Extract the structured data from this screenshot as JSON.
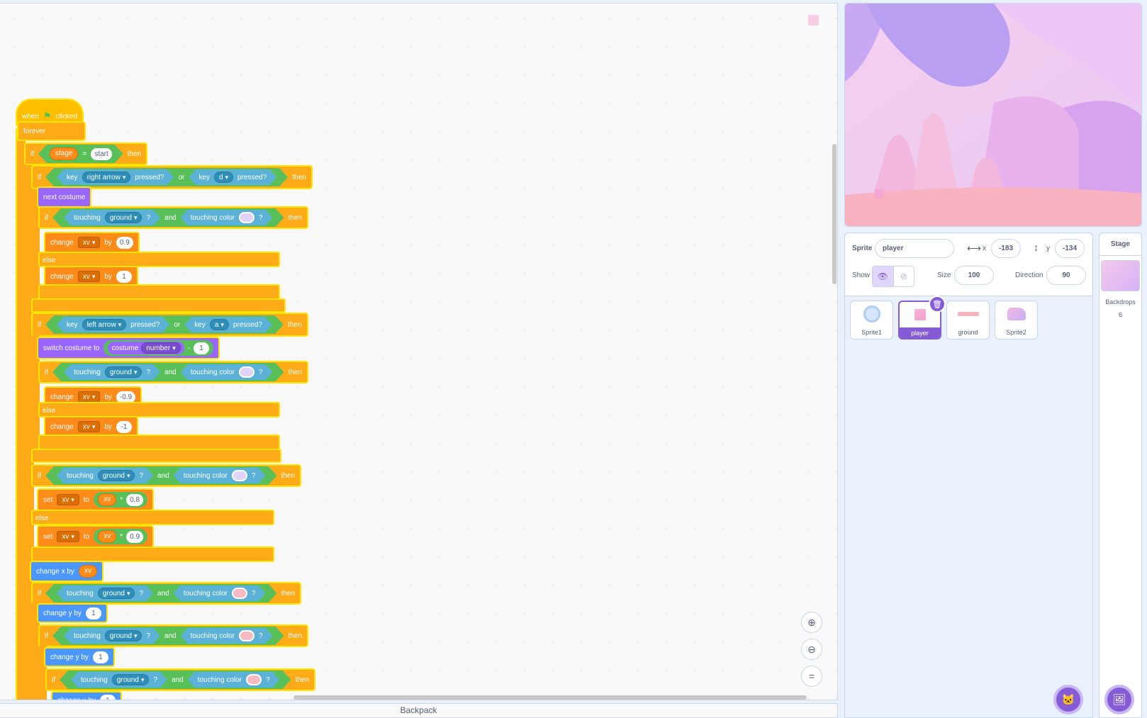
{
  "code": {
    "hat": {
      "when": "when",
      "clicked": "clicked"
    },
    "forever": "forever",
    "if_kw": "if",
    "then_kw": "then",
    "else_kw": "else",
    "or_kw": "or",
    "and_kw": "and",
    "key_kw": "key",
    "pressed_kw": "pressed?",
    "touching_kw": "touching",
    "touching_color_kw": "touching color",
    "qmark": "?",
    "change_kw": "change",
    "by_kw": "by",
    "set_kw": "set",
    "to_kw": "to",
    "eq": "=",
    "minus": "-",
    "times": "*",
    "stage_var": "stage",
    "start_val": "start",
    "right_arrow": "right arrow",
    "left_arrow": "left arrow",
    "key_d": "d",
    "key_a": "a",
    "ground": "ground",
    "xv": "xv",
    "next_costume": "next costume",
    "switch_costume_to": "switch costume to",
    "costume_kw": "costume",
    "number_kw": "number",
    "change_x_by": "change x by",
    "change_y_by": "change y by",
    "values": {
      "v09": "0.9",
      "v1": "1",
      "vm09": "-0.9",
      "vm1": "-1",
      "v08": "0.8",
      "v09b": "0.9",
      "one": "1"
    },
    "colors": {
      "lavender": "#e2d3fb",
      "pink": "#f7b9c4"
    }
  },
  "backpack": "Backpack",
  "sprite_info": {
    "sprite_label": "Sprite",
    "sprite_name": "player",
    "x_label": "x",
    "x_value": "-183",
    "y_label": "y",
    "y_value": "-134",
    "show_label": "Show",
    "size_label": "Size",
    "size_value": "100",
    "direction_label": "Direction",
    "direction_value": "90"
  },
  "sprites": [
    {
      "name": "Sprite1"
    },
    {
      "name": "player"
    },
    {
      "name": "ground"
    },
    {
      "name": "Sprite2"
    }
  ],
  "stage_selector": {
    "title": "Stage",
    "backdrops_label": "Backdrops",
    "backdrops_count": "6"
  }
}
